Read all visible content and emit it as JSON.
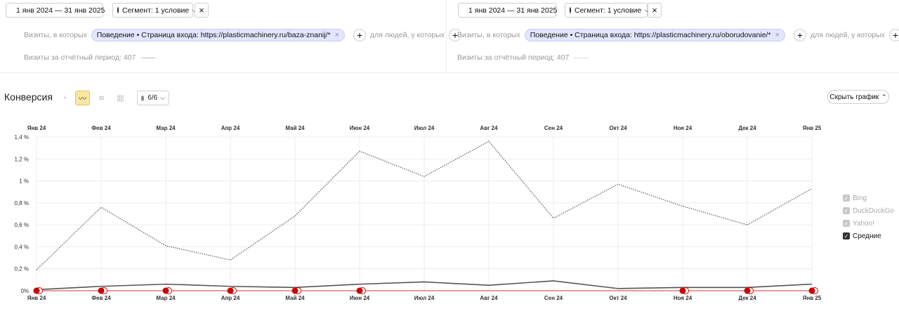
{
  "panels": [
    {
      "date_range": "1 янв 2024 — 31 янв 2025",
      "segment_label": "Сегмент: 1 условие",
      "visits_prefix": "Визиты, в которых",
      "condition_tag": "Поведение • Страница входа: https://plasticmachinery.ru/baza-znanij/*",
      "people_label": "для людей, у которых",
      "visits_summary": "Визиты за отчётный период: 407"
    },
    {
      "date_range": "1 янв 2024 — 31 янв 2025",
      "segment_label": "Сегмент: 1 условие",
      "visits_prefix": "Визиты, в которых",
      "condition_tag": "Поведение • Страница входа: https://plasticmachinery.ru/oborudovanie/*",
      "people_label": "для людей, у которых",
      "visits_summary": "Визиты за отчётный период: 407"
    }
  ],
  "toolbar": {
    "title": "Конверсия",
    "notes_count": "6/6",
    "hide_chart": "Скрыть график"
  },
  "legend": [
    {
      "label": "Bing",
      "checked": false
    },
    {
      "label": "DuckDuckGo",
      "checked": false
    },
    {
      "label": "Yahoo!",
      "checked": false
    },
    {
      "label": "Средние",
      "checked": true
    }
  ],
  "colors": {
    "accent": "#fbe7a1",
    "tag_bg": "#e3e6ff",
    "marker": "#cc0000",
    "series1": "#555555",
    "series2": "#555555",
    "baseline": "#d23b1e"
  },
  "chart_data": {
    "type": "line",
    "categories": [
      "Янв 24",
      "Фев 24",
      "Мар 24",
      "Апр 24",
      "Май 24",
      "Июн 24",
      "Июл 24",
      "Авг 24",
      "Сен 24",
      "Окт 24",
      "Ноя 24",
      "Дек 24",
      "Янв 25"
    ],
    "y_ticks": [
      "0%",
      "0,2 %",
      "0,4 %",
      "0,6 %",
      "0,8 %",
      "1 %",
      "1,2 %",
      "1,4 %"
    ],
    "ylim": [
      0,
      1.4
    ],
    "grid": true,
    "series": [
      {
        "style": "dotted",
        "values": [
          0.19,
          0.76,
          0.41,
          0.28,
          0.68,
          1.27,
          1.04,
          1.36,
          0.66,
          0.97,
          0.77,
          0.6,
          0.93
        ]
      },
      {
        "style": "solid",
        "values": [
          0.01,
          0.04,
          0.06,
          0.04,
          0.03,
          0.06,
          0.08,
          0.05,
          0.09,
          0.02,
          0.03,
          0.03,
          0.06
        ]
      },
      {
        "style": "baseline",
        "values": [
          0,
          0,
          0,
          0,
          0,
          0,
          0,
          0,
          0,
          0,
          0,
          0,
          0
        ]
      }
    ],
    "markers": [
      0,
      1,
      2,
      3,
      4,
      5,
      10,
      11,
      12
    ],
    "legend_position": "right"
  }
}
